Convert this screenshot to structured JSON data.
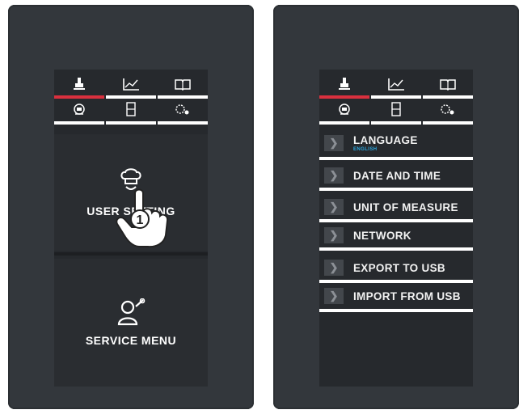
{
  "left_screen": {
    "tabs": [
      {
        "icon": "chef-hat-icon"
      },
      {
        "icon": "chart-icon"
      },
      {
        "icon": "book-icon"
      },
      {
        "icon": "pan-icon"
      },
      {
        "icon": "oven-icon"
      },
      {
        "icon": "gear-icon"
      }
    ],
    "user_settings_label": "USER SETTING",
    "hand_number": "1",
    "service_menu_label": "SERVICE MENU"
  },
  "right_screen": {
    "tabs": [
      {
        "icon": "chef-hat-icon"
      },
      {
        "icon": "chart-icon"
      },
      {
        "icon": "book-icon"
      },
      {
        "icon": "pan-icon"
      },
      {
        "icon": "oven-icon"
      },
      {
        "icon": "gear-icon"
      }
    ],
    "menu": [
      {
        "label": "LANGUAGE",
        "sub": "ENGLISH"
      },
      {
        "label": "DATE AND TIME"
      },
      {
        "label": "UNIT OF MEASURE"
      },
      {
        "label": "NETWORK"
      },
      {
        "label": "EXPORT TO USB"
      },
      {
        "label": "IMPORT FROM USB"
      }
    ]
  },
  "colors": {
    "device": "#33373c",
    "screen": "#26292d",
    "active_tab": "#d9303e",
    "accent_text": "#2aa8e0"
  }
}
